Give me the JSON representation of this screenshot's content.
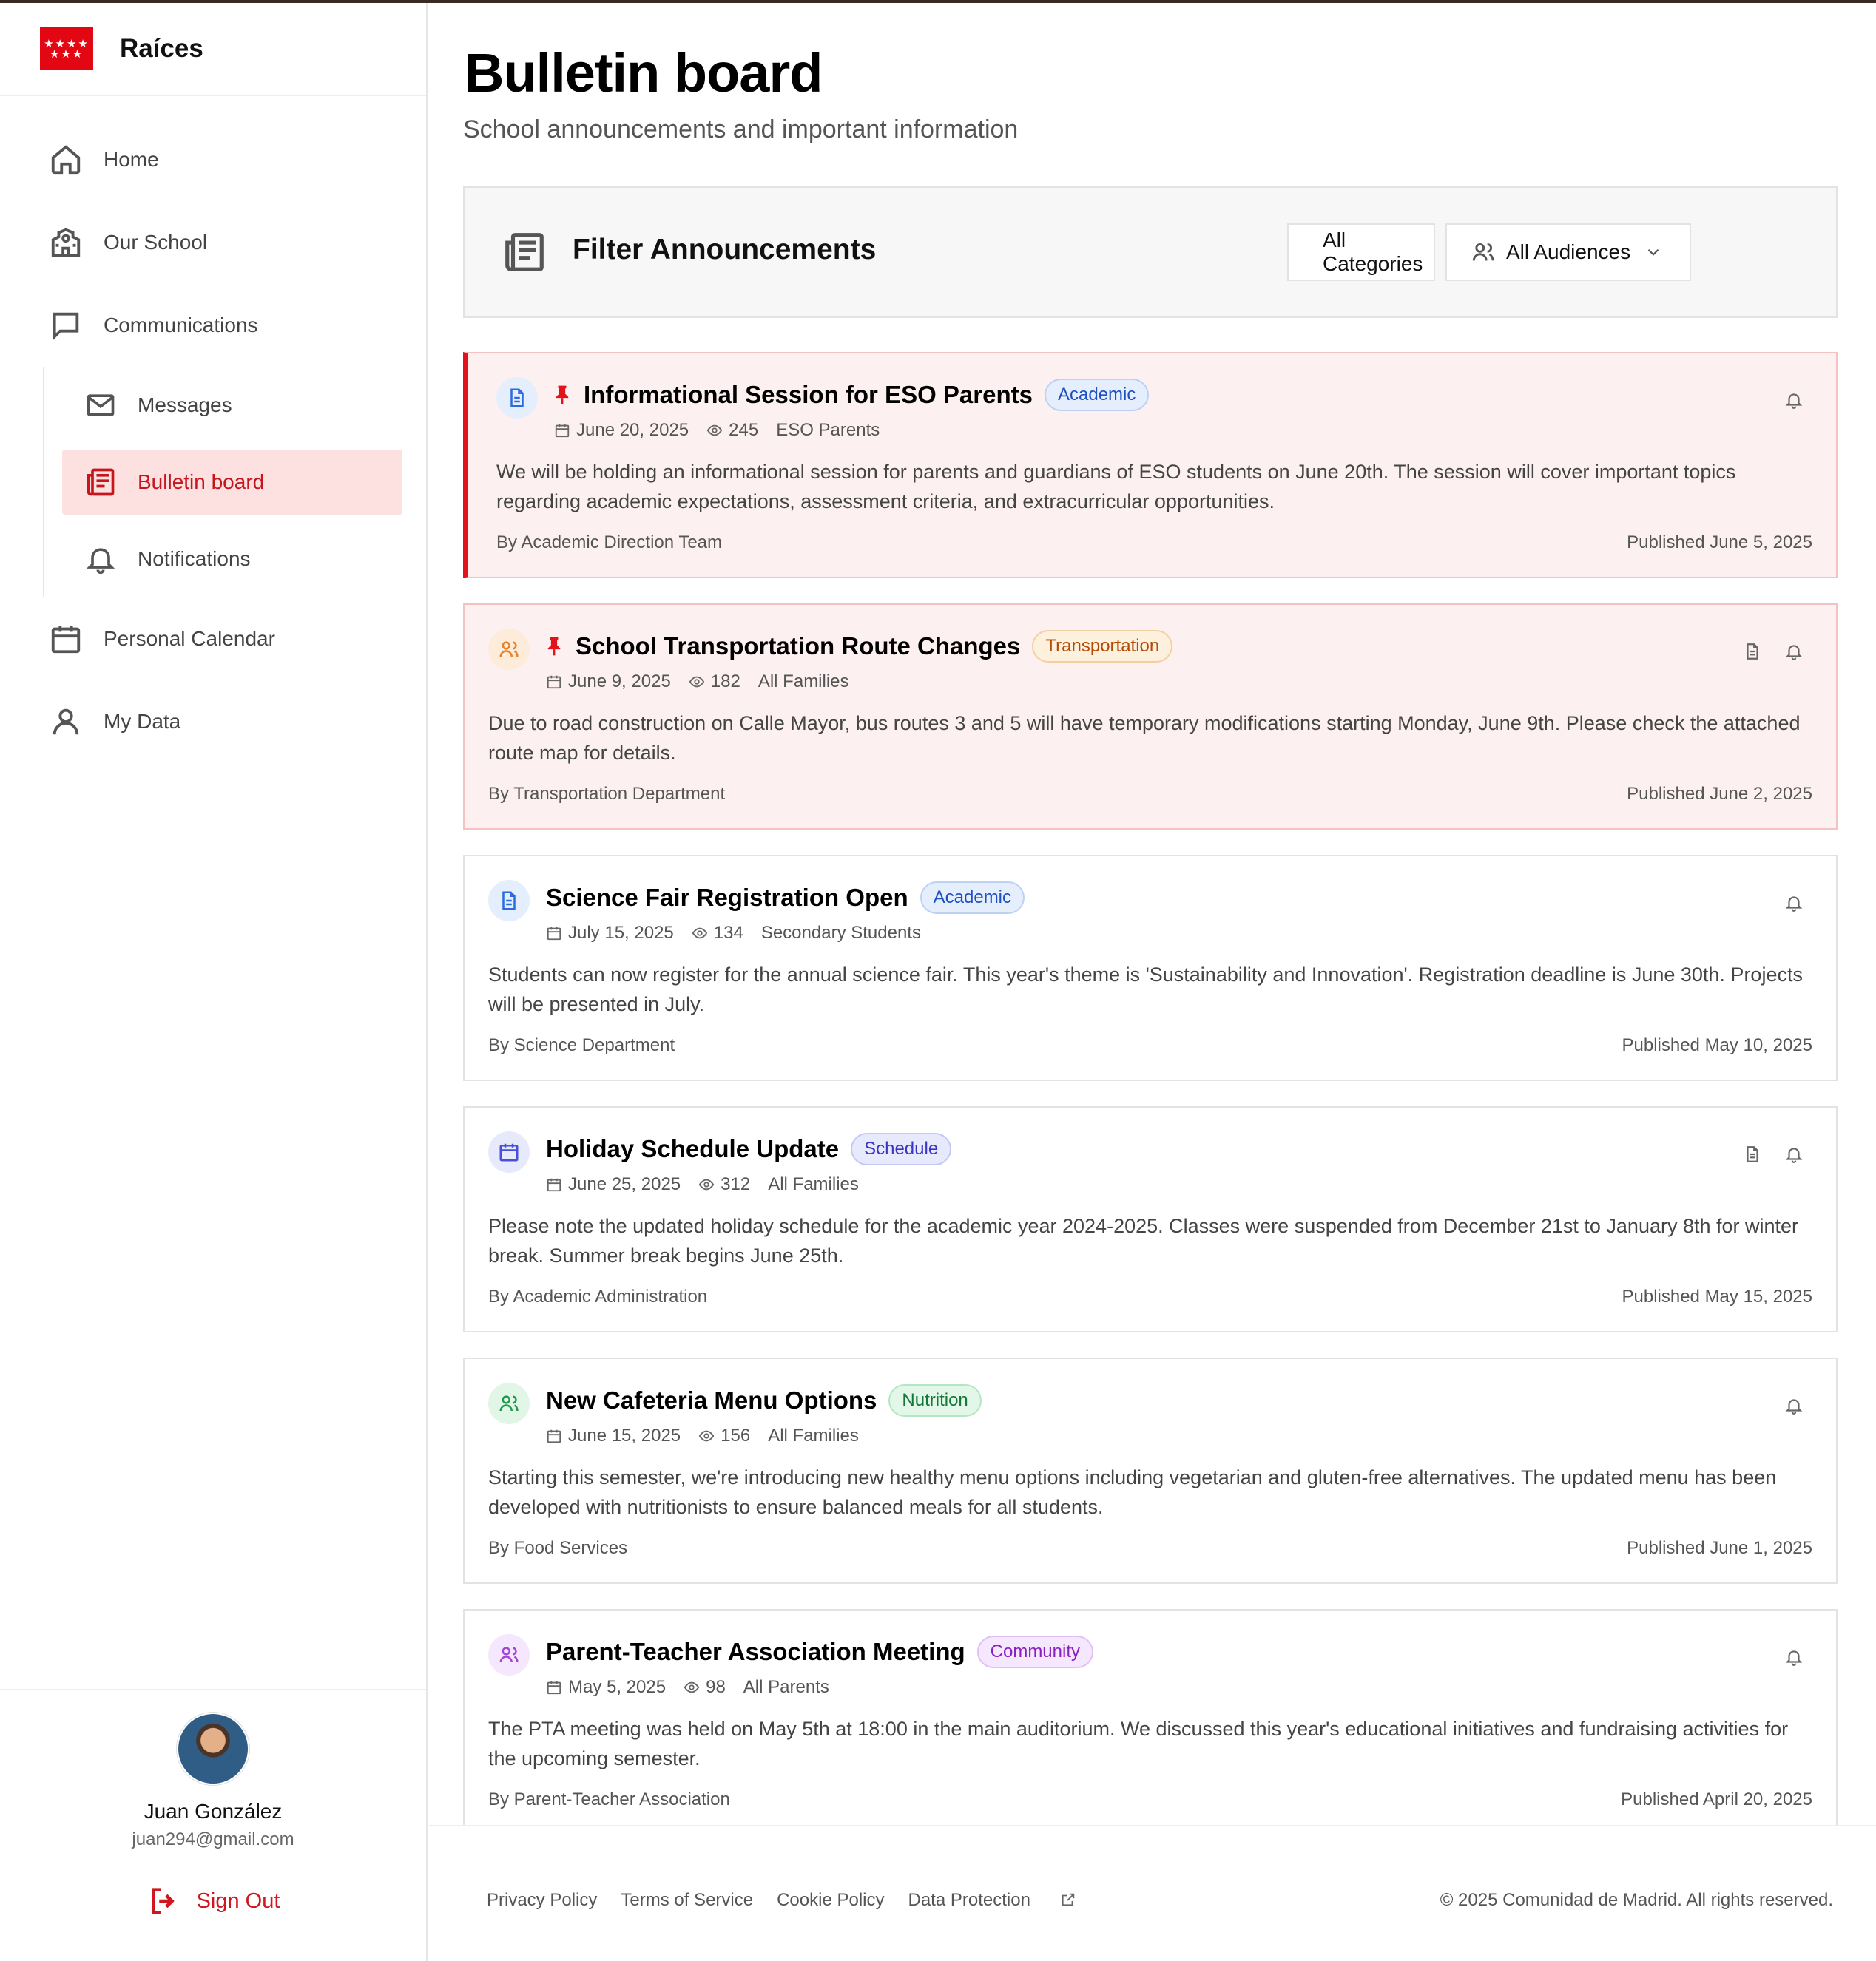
{
  "brand": {
    "name": "Raíces",
    "flag_stars_top": "★★★★",
    "flag_stars_bottom": "★★★"
  },
  "sidebar": {
    "items": [
      {
        "label": "Home",
        "icon": "home-icon"
      },
      {
        "label": "Our School",
        "icon": "school-icon"
      },
      {
        "label": "Communications",
        "icon": "chat-icon"
      }
    ],
    "subitems": [
      {
        "label": "Messages",
        "icon": "mail-icon"
      },
      {
        "label": "Bulletin board",
        "icon": "newspaper-icon",
        "active": true
      },
      {
        "label": "Notifications",
        "icon": "bell-icon"
      }
    ],
    "items_after": [
      {
        "label": "Personal Calendar",
        "icon": "calendar-icon"
      },
      {
        "label": "My Data",
        "icon": "user-icon"
      }
    ]
  },
  "user": {
    "name": "Juan González",
    "email": "juan294@gmail.com",
    "sign_out": "Sign Out"
  },
  "page": {
    "title": "Bulletin board",
    "subtitle": "School announcements and important information"
  },
  "filters": {
    "title": "Filter Announcements",
    "category": "All Categories",
    "audience": "All Audiences"
  },
  "announcements": [
    {
      "title": "Informational Session for ESO Parents",
      "tag": "Academic",
      "date": "June 20, 2025",
      "views": "245",
      "audience": "ESO Parents",
      "body": "We will be holding an informational session for parents and guardians of ESO students on June 20th. The session will cover important topics regarding academic expectations, assessment criteria, and extracurricular opportunities.",
      "author": "By Academic Direction Team",
      "published": "Published June 5, 2025"
    },
    {
      "title": "School Transportation Route Changes",
      "tag": "Transportation",
      "date": "June 9, 2025",
      "views": "182",
      "audience": "All Families",
      "body": "Due to road construction on Calle Mayor, bus routes 3 and 5 will have temporary modifications starting Monday, June 9th. Please check the attached route map for details.",
      "author": "By Transportation Department",
      "published": "Published June 2, 2025"
    },
    {
      "title": "Science Fair Registration Open",
      "tag": "Academic",
      "date": "July 15, 2025",
      "views": "134",
      "audience": "Secondary Students",
      "body": "Students can now register for the annual science fair. This year's theme is 'Sustainability and Innovation'. Registration deadline is June 30th. Projects will be presented in July.",
      "author": "By Science Department",
      "published": "Published May 10, 2025"
    },
    {
      "title": "Holiday Schedule Update",
      "tag": "Schedule",
      "date": "June 25, 2025",
      "views": "312",
      "audience": "All Families",
      "body": "Please note the updated holiday schedule for the academic year 2024-2025. Classes were suspended from December 21st to January 8th for winter break. Summer break begins June 25th.",
      "author": "By Academic Administration",
      "published": "Published May 15, 2025"
    },
    {
      "title": "New Cafeteria Menu Options",
      "tag": "Nutrition",
      "date": "June 15, 2025",
      "views": "156",
      "audience": "All Families",
      "body": "Starting this semester, we're introducing new healthy menu options including vegetarian and gluten-free alternatives. The updated menu has been developed with nutritionists to ensure balanced meals for all students.",
      "author": "By Food Services",
      "published": "Published June 1, 2025"
    },
    {
      "title": "Parent-Teacher Association Meeting",
      "tag": "Community",
      "date": "May 5, 2025",
      "views": "98",
      "audience": "All Parents",
      "body": "The PTA meeting was held on May 5th at 18:00 in the main auditorium. We discussed this year's educational initiatives and fundraising activities for the upcoming semester.",
      "author": "By Parent-Teacher Association",
      "published": "Published April 20, 2025"
    }
  ],
  "footer": {
    "links": [
      "Privacy Policy",
      "Terms of Service",
      "Cookie Policy",
      "Data Protection"
    ],
    "copyright": "© 2025 Comunidad de Madrid. All rights reserved."
  },
  "colors": {
    "accent": "#e3131b",
    "active_bg": "#fde0e0",
    "pinned_bg": "#fdf0f0"
  }
}
